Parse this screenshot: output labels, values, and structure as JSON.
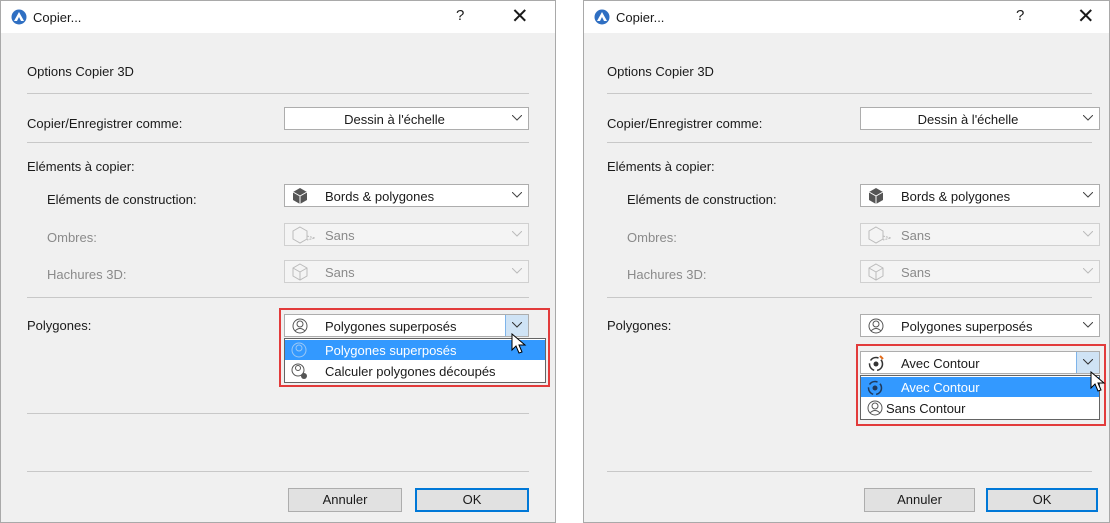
{
  "left": {
    "title": "Copier...",
    "help": "?",
    "close": "✕",
    "section_title": "Options Copier 3D",
    "copy_as_label": "Copier/Enregistrer comme:",
    "copy_as_value": "Dessin à l'échelle",
    "elements_label": "Eléments à copier:",
    "construction_label": "Eléments de construction:",
    "construction_value": "Bords & polygones",
    "shadows_label": "Ombres:",
    "shadows_value": "Sans",
    "hatch_label": "Hachures 3D:",
    "hatch_value": "Sans",
    "polygons_label": "Polygones:",
    "polygons_value": "Polygones superposés",
    "dropdown_items": [
      "Polygones superposés",
      "Calculer polygones découpés"
    ],
    "cancel": "Annuler",
    "ok": "OK"
  },
  "right": {
    "title": "Copier...",
    "help": "?",
    "close": "✕",
    "section_title": "Options Copier 3D",
    "copy_as_label": "Copier/Enregistrer comme:",
    "copy_as_value": "Dessin à l'échelle",
    "elements_label": "Eléments à copier:",
    "construction_label": "Eléments de construction:",
    "construction_value": "Bords & polygones",
    "shadows_label": "Ombres:",
    "shadows_value": "Sans",
    "hatch_label": "Hachures 3D:",
    "hatch_value": "Sans",
    "polygons_label": "Polygones:",
    "polygons_value": "Polygones superposés",
    "contour_value": "Avec Contour",
    "dropdown_items": [
      "Avec Contour",
      "Sans Contour"
    ],
    "cancel": "Annuler",
    "ok": "OK"
  },
  "colors": {
    "highlight": "#3399ff",
    "callout": "#e23b3b",
    "default_button": "#0078d7"
  }
}
